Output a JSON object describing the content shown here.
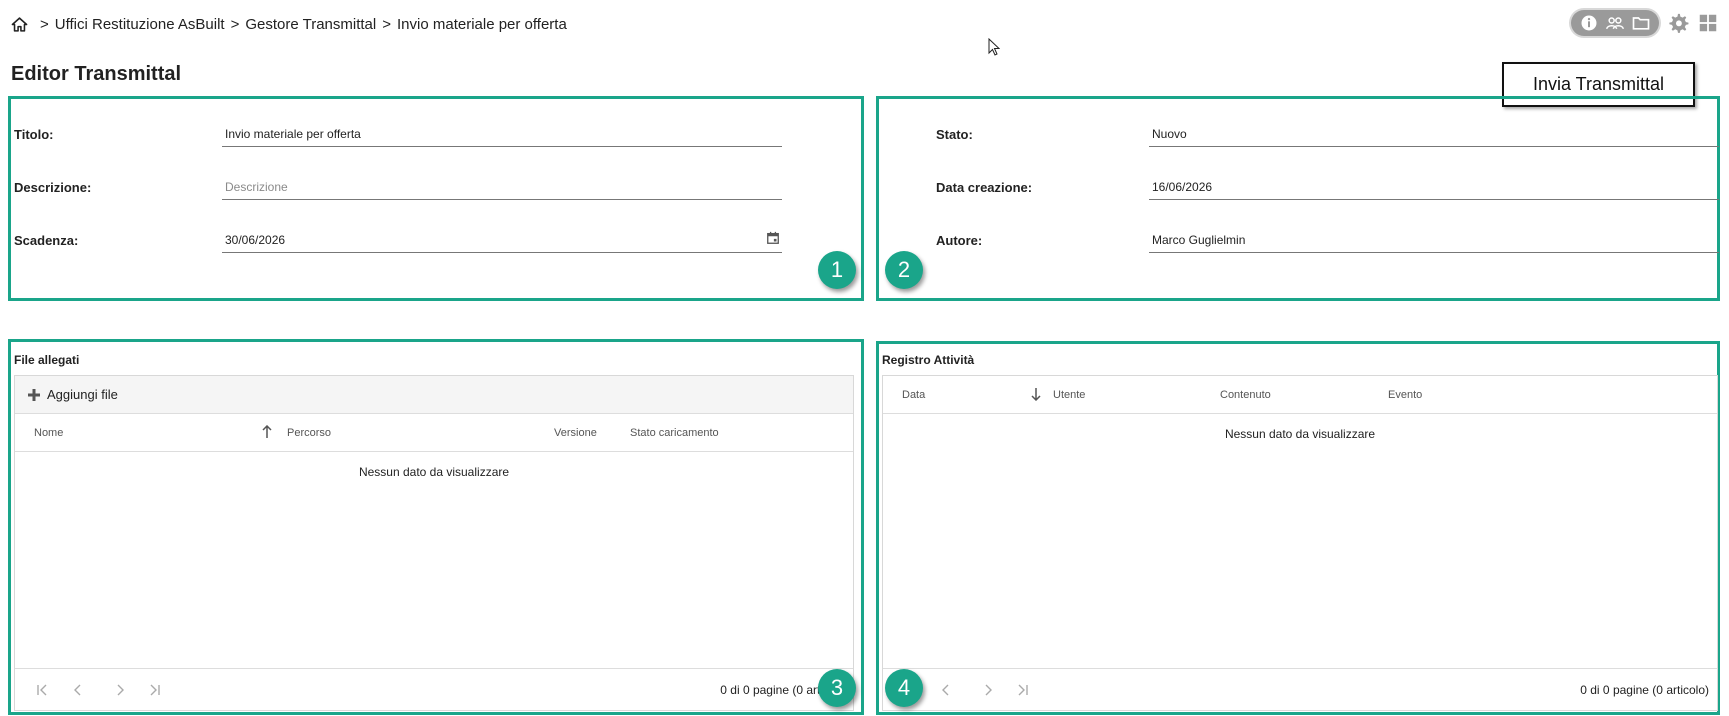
{
  "breadcrumb": {
    "separator": ">",
    "items": [
      "Uffici Restituzione AsBuilt",
      "Gestore Transmittal",
      "Invio materiale per offerta"
    ]
  },
  "header": {
    "title": "Editor Transmittal",
    "send_button": "Invia Transmittal",
    "icons": [
      "info-icon",
      "users-icon",
      "folder-icon",
      "gear-icon",
      "grid-apps-icon"
    ]
  },
  "panel1": {
    "badge": "1",
    "titolo_label": "Titolo:",
    "titolo_value": "Invio materiale per offerta",
    "descrizione_label": "Descrizione:",
    "descrizione_placeholder": "Descrizione",
    "scadenza_label": "Scadenza:",
    "scadenza_value": "30/06/2026"
  },
  "panel2": {
    "badge": "2",
    "stato_label": "Stato:",
    "stato_value": "Nuovo",
    "data_label": "Data creazione:",
    "data_value": "16/06/2026",
    "autore_label": "Autore:",
    "autore_value": "Marco Guglielmin"
  },
  "panel3": {
    "badge": "3",
    "title": "File allegati",
    "add_label": "Aggiungi file",
    "columns": [
      "Nome",
      "Percorso",
      "Versione",
      "Stato caricamento"
    ],
    "empty": "Nessun dato da visualizzare",
    "pager_info": "0 di 0 pagine (0 articoli)"
  },
  "panel4": {
    "badge": "4",
    "title": "Registro Attività",
    "columns": [
      "Data",
      "Utente",
      "Contenuto",
      "Evento"
    ],
    "empty": "Nessun dato da visualizzare",
    "pager_info": "0 di 0 pagine (0 articolo)"
  },
  "colors": {
    "accent": "#1aa58a"
  }
}
